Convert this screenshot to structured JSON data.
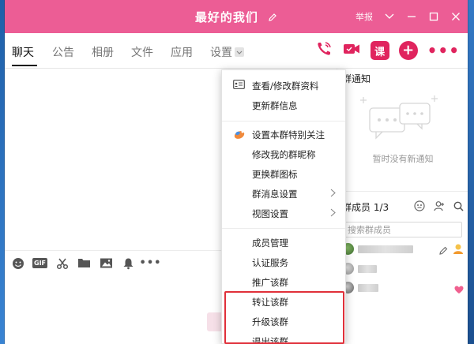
{
  "window": {
    "title": "最好的我们",
    "report_label": "举报"
  },
  "tabs": [
    {
      "label": "聊天",
      "active": true
    },
    {
      "label": "公告"
    },
    {
      "label": "相册"
    },
    {
      "label": "文件"
    },
    {
      "label": "应用"
    },
    {
      "label": "设置"
    }
  ],
  "header_icons": {
    "class_label": "课",
    "add_label": "+",
    "more_label": "•••"
  },
  "notice": {
    "title": "群通知",
    "empty_text": "暂时没有新通知"
  },
  "members": {
    "title": "群成员 1/3",
    "search_placeholder": "搜索群成员"
  },
  "menu": {
    "items": [
      {
        "label": "查看/修改群资料",
        "icon": "profile-card-icon"
      },
      {
        "label": "更新群信息"
      },
      {
        "label": "设置本群特别关注",
        "icon": "special-attention-icon"
      },
      {
        "label": "修改我的群昵称"
      },
      {
        "label": "更换群图标"
      },
      {
        "label": "群消息设置",
        "submenu": true
      },
      {
        "label": "视图设置",
        "submenu": true
      },
      {
        "label": "成员管理"
      },
      {
        "label": "认证服务"
      },
      {
        "label": "推广该群"
      },
      {
        "label": "转让该群"
      },
      {
        "label": "升级该群"
      },
      {
        "label": "退出该群"
      }
    ]
  },
  "toolbar": {
    "gif_label": "GIF",
    "more_label": "•••"
  },
  "colors": {
    "title_bar": "#ec5d95",
    "accent": "#e0245e",
    "highlight_box": "#e0303a"
  }
}
